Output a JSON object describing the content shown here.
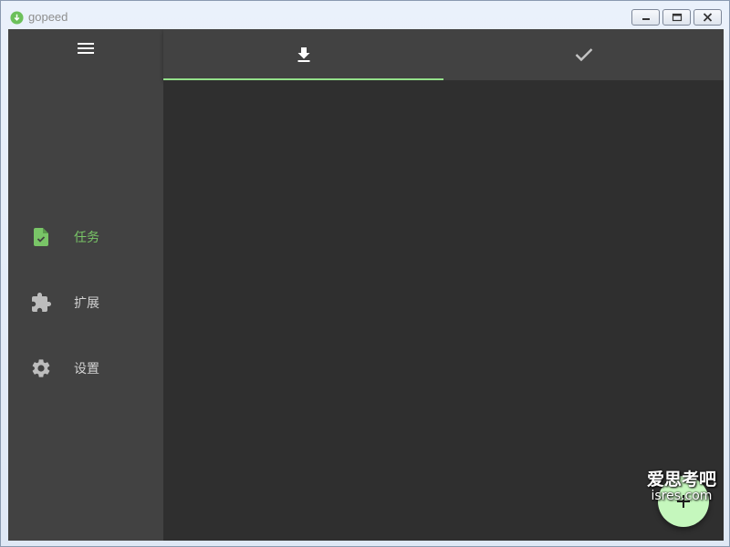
{
  "window": {
    "title": "gopeed",
    "brand_color": "#6cc05b",
    "controls": [
      "minimize-icon",
      "maximize-icon",
      "close-icon"
    ]
  },
  "sidebar": {
    "menu_icon": "menu-icon",
    "items": [
      {
        "label": "任务",
        "icon": "task-file-check-icon",
        "active": true
      },
      {
        "label": "扩展",
        "icon": "puzzle-icon",
        "active": false
      },
      {
        "label": "设置",
        "icon": "gear-icon",
        "active": false
      }
    ]
  },
  "tabs": [
    {
      "icon": "download-icon",
      "active": true
    },
    {
      "icon": "check-icon",
      "active": false
    }
  ],
  "fab": {
    "icon": "add-icon"
  },
  "watermark": {
    "line1": "爱思考吧",
    "line2": "isres.com"
  },
  "colors": {
    "sidebar_bg": "#424242",
    "content_bg": "#2f2f2f",
    "accent": "#79c567",
    "tab_indicator": "#93e08a",
    "fab_bg": "#c5f7bd"
  }
}
